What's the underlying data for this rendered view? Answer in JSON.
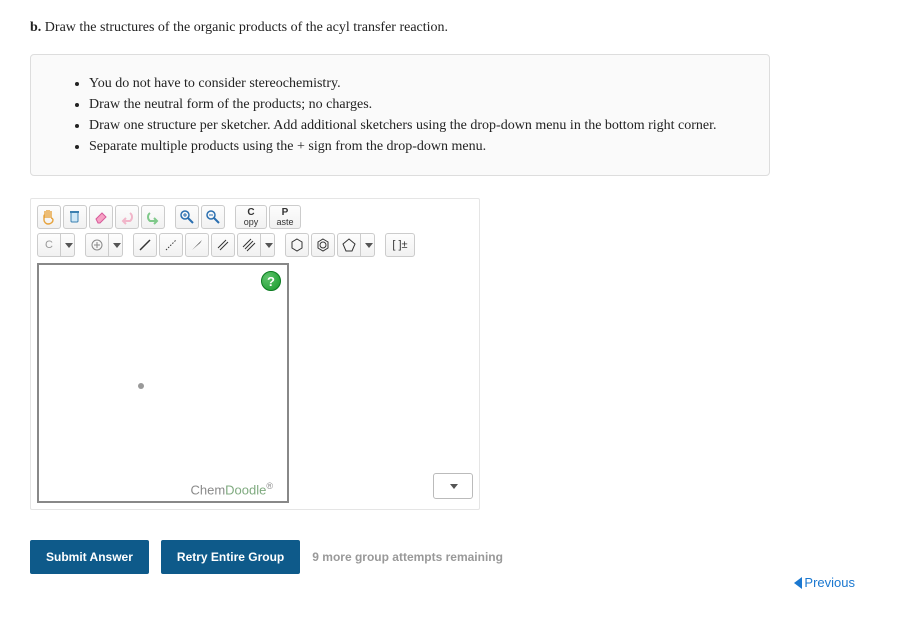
{
  "question": {
    "label": "b.",
    "text": "Draw the structures of the organic products of the acyl transfer reaction."
  },
  "instructions": [
    "You do not have to consider stereochemistry.",
    "Draw the neutral form of the products; no charges.",
    "Draw one structure per sketcher. Add additional sketchers using the drop-down menu in the bottom right corner.",
    "Separate multiple products using the + sign from the drop-down menu."
  ],
  "toolbar_row1": {
    "copy_top": "C",
    "copy_bottom": "opy",
    "paste_top": "P",
    "paste_bottom": "aste"
  },
  "toolbar_row2": {
    "atom": "C",
    "charge": "[ ]±"
  },
  "help": "?",
  "brand_prefix": "Chem",
  "brand_suffix": "Doodle",
  "brand_reg": "®",
  "buttons": {
    "submit": "Submit Answer",
    "retry": "Retry Entire Group"
  },
  "attempts": "9 more group attempts remaining",
  "previous": "Previous"
}
